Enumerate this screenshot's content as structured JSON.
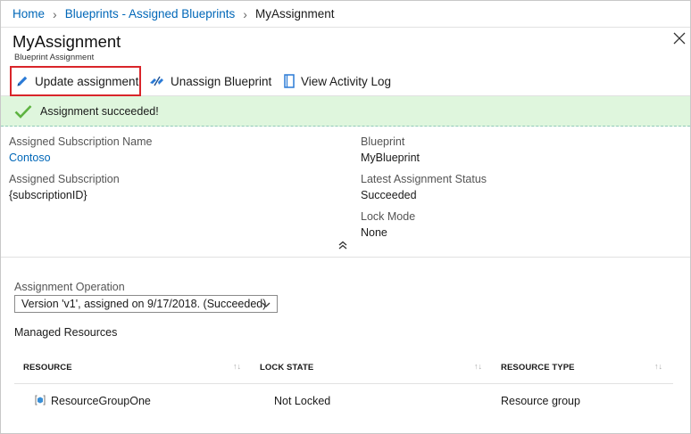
{
  "breadcrumb": {
    "items": [
      "Home",
      "Blueprints - Assigned Blueprints"
    ],
    "current": "MyAssignment"
  },
  "header": {
    "title": "MyAssignment",
    "subtitle": "Blueprint Assignment"
  },
  "toolbar": {
    "update_label": "Update assignment",
    "unassign_label": "Unassign Blueprint",
    "activity_label": "View Activity Log"
  },
  "banner": {
    "message": "Assignment succeeded!",
    "color": "#dff6dd",
    "check_color": "#5db340"
  },
  "essentials": {
    "subscription_name_label": "Assigned Subscription Name",
    "subscription_name_value": "Contoso",
    "subscription_label": "Assigned Subscription",
    "subscription_value": "{subscriptionID}",
    "blueprint_label": "Blueprint",
    "blueprint_value": "MyBlueprint",
    "status_label": "Latest Assignment Status",
    "status_value": "Succeeded",
    "lock_label": "Lock Mode",
    "lock_value": "None"
  },
  "operation": {
    "label": "Assignment Operation",
    "selected": "Version 'v1', assigned on 9/17/2018. (Succeeded)"
  },
  "managed": {
    "title": "Managed Resources",
    "columns": [
      "RESOURCE",
      "LOCK STATE",
      "RESOURCE TYPE"
    ],
    "rows": [
      {
        "resource": "ResourceGroupOne",
        "lock_state": "Not Locked",
        "resource_type": "Resource group"
      }
    ]
  },
  "colors": {
    "link": "#0067b8",
    "highlight_border": "#d9252a"
  }
}
